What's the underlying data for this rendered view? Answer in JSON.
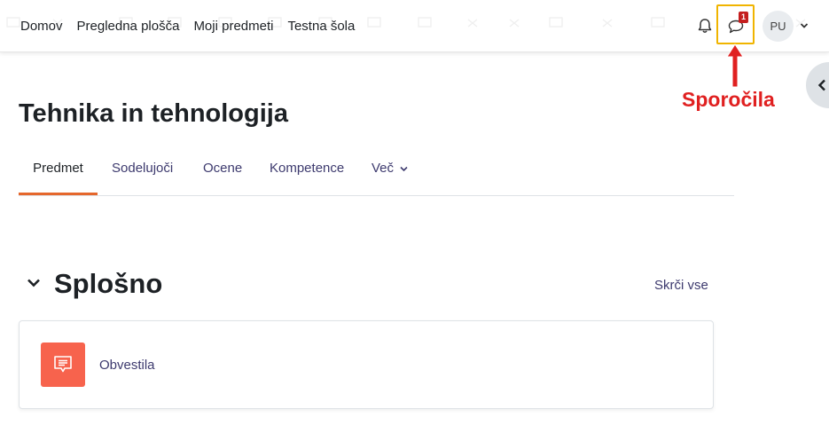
{
  "navbar": {
    "links": [
      "Domov",
      "Pregledna plošča",
      "Moji predmeti",
      "Testna šola"
    ],
    "notifications_icon": "bell-icon",
    "messages_icon": "speech-bubble-icon",
    "messages_badge": "1",
    "user_initials": "PU"
  },
  "annotation": {
    "label": "Sporočila",
    "color": "#e02020",
    "highlight_color": "#f0b400"
  },
  "drawer": {
    "toggle_icon": "chevron-left-icon"
  },
  "course": {
    "title": "Tehnika in tehnologija",
    "tabs": [
      {
        "label": "Predmet",
        "active": true
      },
      {
        "label": "Sodelujoči",
        "active": false
      },
      {
        "label": "Ocene",
        "active": false
      },
      {
        "label": "Kompetence",
        "active": false
      },
      {
        "label": "Več",
        "active": false
      }
    ]
  },
  "section": {
    "title": "Splošno",
    "collapse_label": "Skrči vse",
    "activities": [
      {
        "name": "Obvestila",
        "icon": "forum-icon",
        "icon_color": "#f7634d"
      }
    ]
  },
  "colors": {
    "link": "#3d3a6e",
    "active_tab_underline": "#e5672c",
    "badge": "#c41e1e"
  }
}
